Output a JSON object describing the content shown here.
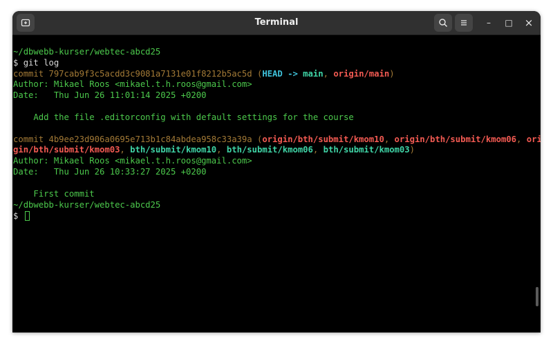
{
  "window": {
    "title": "Terminal"
  },
  "icons": {
    "new_tab": "new-tab-icon",
    "search": "search-icon",
    "menu": "hamburger-menu-icon",
    "minimize": "minimize-icon",
    "maximize": "maximize-icon",
    "close": "close-icon"
  },
  "controls": {
    "minimize": "–",
    "maximize": "□",
    "close": "×"
  },
  "colors": {
    "prompt": "#4cc94c",
    "commit": "#a37a36",
    "head": "#3fc1d9",
    "local_branch": "#3fd4a6",
    "remote_branch": "#f25a52",
    "background": "#000000"
  },
  "terminal": {
    "path1": "~/dbwebb-kurser/webtec-abcd25",
    "prompt1": "$ git log",
    "commit1": {
      "hash_text": "commit 797cab9f3c5acdd3c9081a7131e01f8212b5ac5d",
      "open": " (",
      "head": "HEAD",
      "arrow": " -> ",
      "branch_main": "main",
      "sep": ", ",
      "remote_main": "origin/main",
      "close": ")",
      "author": "Author: Mikael Roos <mikael.t.h.roos@gmail.com>",
      "date": "Date:   Thu Jun 26 11:01:14 2025 +0200",
      "message": "    Add the file .editorconfig with default settings for the course"
    },
    "commit2": {
      "hash_text": "commit 4b9ee23d906a0695e713b1c84abdea958c33a39a",
      "open": " (",
      "ref1": "origin/bth/submit/kmom10",
      "sep": ", ",
      "ref2": "origin/bth/submit/kmom06",
      "ref3_part1": "ori",
      "ref3_part2": "gin/bth/submit/kmom03",
      "ref4": "bth/submit/kmom10",
      "ref5": "bth/submit/kmom06",
      "ref6": "bth/submit/kmom03",
      "close": ")",
      "author": "Author: Mikael Roos <mikael.t.h.roos@gmail.com>",
      "date": "Date:   Thu Jun 26 10:33:27 2025 +0200",
      "message": "    First commit"
    },
    "path2": "~/dbwebb-kurser/webtec-abcd25",
    "prompt2": "$ "
  }
}
